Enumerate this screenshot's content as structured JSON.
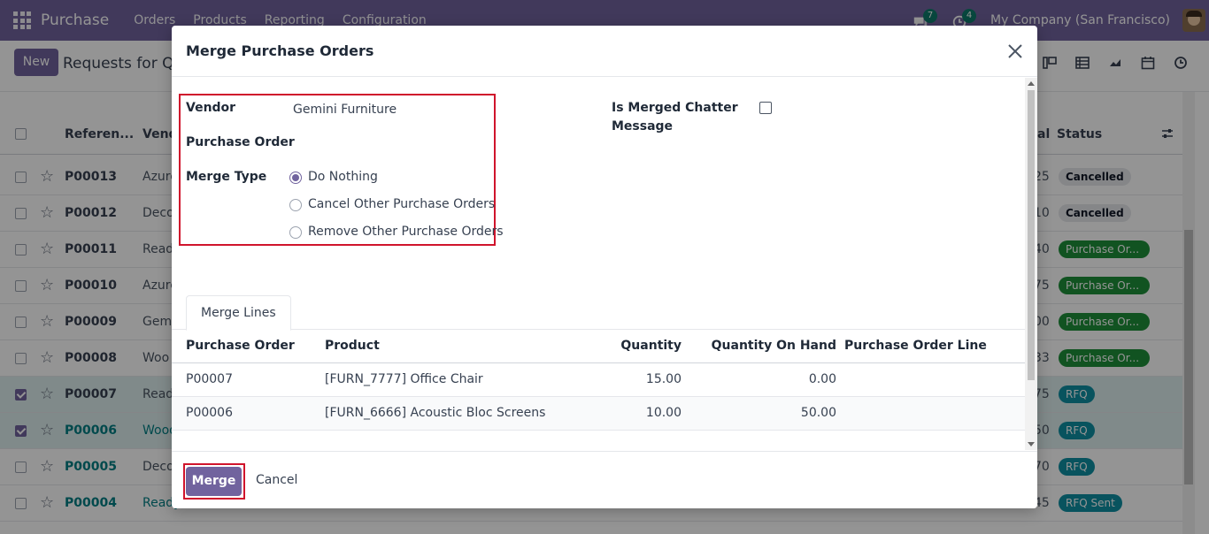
{
  "navbar": {
    "brand": "Purchase",
    "menu": [
      "Orders",
      "Products",
      "Reporting",
      "Configuration"
    ],
    "messages_count": "7",
    "activities_count": "4",
    "company": "My Company (San Francisco)"
  },
  "control_panel": {
    "new_label": "New",
    "title": "Requests for Qu"
  },
  "list": {
    "headers": {
      "reference": "Referen...",
      "vendor": "Vend",
      "total": "al",
      "status": "Status"
    },
    "rows": [
      {
        "ref": "P00013",
        "vendor": "Azure",
        "total": "25",
        "status": "Cancelled",
        "kind": "cancel",
        "selected": false
      },
      {
        "ref": "P00012",
        "vendor": "Deco",
        "total": "10",
        "status": "Cancelled",
        "kind": "cancel",
        "selected": false
      },
      {
        "ref": "P00011",
        "vendor": "Read",
        "total": "40",
        "status": "Purchase Or...",
        "kind": "po",
        "selected": false
      },
      {
        "ref": "P00010",
        "vendor": "Azure",
        "total": "75",
        "status": "Purchase Or...",
        "kind": "po",
        "selected": false
      },
      {
        "ref": "P00009",
        "vendor": "Gemi",
        "total": "00",
        "status": "Purchase Or...",
        "kind": "po",
        "selected": false
      },
      {
        "ref": "P00008",
        "vendor": "Woo",
        "total": "33",
        "status": "Purchase Or...",
        "kind": "po",
        "selected": false
      },
      {
        "ref": "P00007",
        "vendor": "Read",
        "total": "75",
        "status": "RFQ",
        "kind": "rfq",
        "selected": true
      },
      {
        "ref": "P00006",
        "vendor": "Wood",
        "total": "50",
        "status": "RFQ",
        "kind": "rfq",
        "selected": true
      },
      {
        "ref": "P00005",
        "vendor": "Deco",
        "total": "70",
        "status": "RFQ",
        "kind": "rfq",
        "selected": false
      },
      {
        "ref": "P00004",
        "vendor": "Ready",
        "total": "45",
        "status": "RFQ Sent",
        "kind": "rfq",
        "selected": false
      }
    ]
  },
  "dialog": {
    "title": "Merge Purchase Orders",
    "vendor_label": "Vendor",
    "vendor_value": "Gemini Furniture",
    "purchase_order_label": "Purchase Order",
    "merge_type_label": "Merge Type",
    "merge_options": [
      "Do Nothing",
      "Cancel Other Purchase Orders",
      "Remove Other Purchase Orders"
    ],
    "merge_selected": "Do Nothing",
    "chatter_label_1": "Is Merged Chatter",
    "chatter_label_2": "Message",
    "tab_label": "Merge Lines",
    "table": {
      "headers": [
        "Purchase Order",
        "Product",
        "Quantity",
        "Quantity On Hand",
        "Purchase Order Line"
      ],
      "rows": [
        {
          "po": "P00007",
          "product": "[FURN_7777] Office Chair",
          "qty": "15.00",
          "onhand": "0.00",
          "pol": ""
        },
        {
          "po": "P00006",
          "product": "[FURN_6666] Acoustic Bloc Screens",
          "qty": "10.00",
          "onhand": "50.00",
          "pol": ""
        }
      ]
    },
    "merge_button": "Merge",
    "cancel_button": "Cancel"
  }
}
